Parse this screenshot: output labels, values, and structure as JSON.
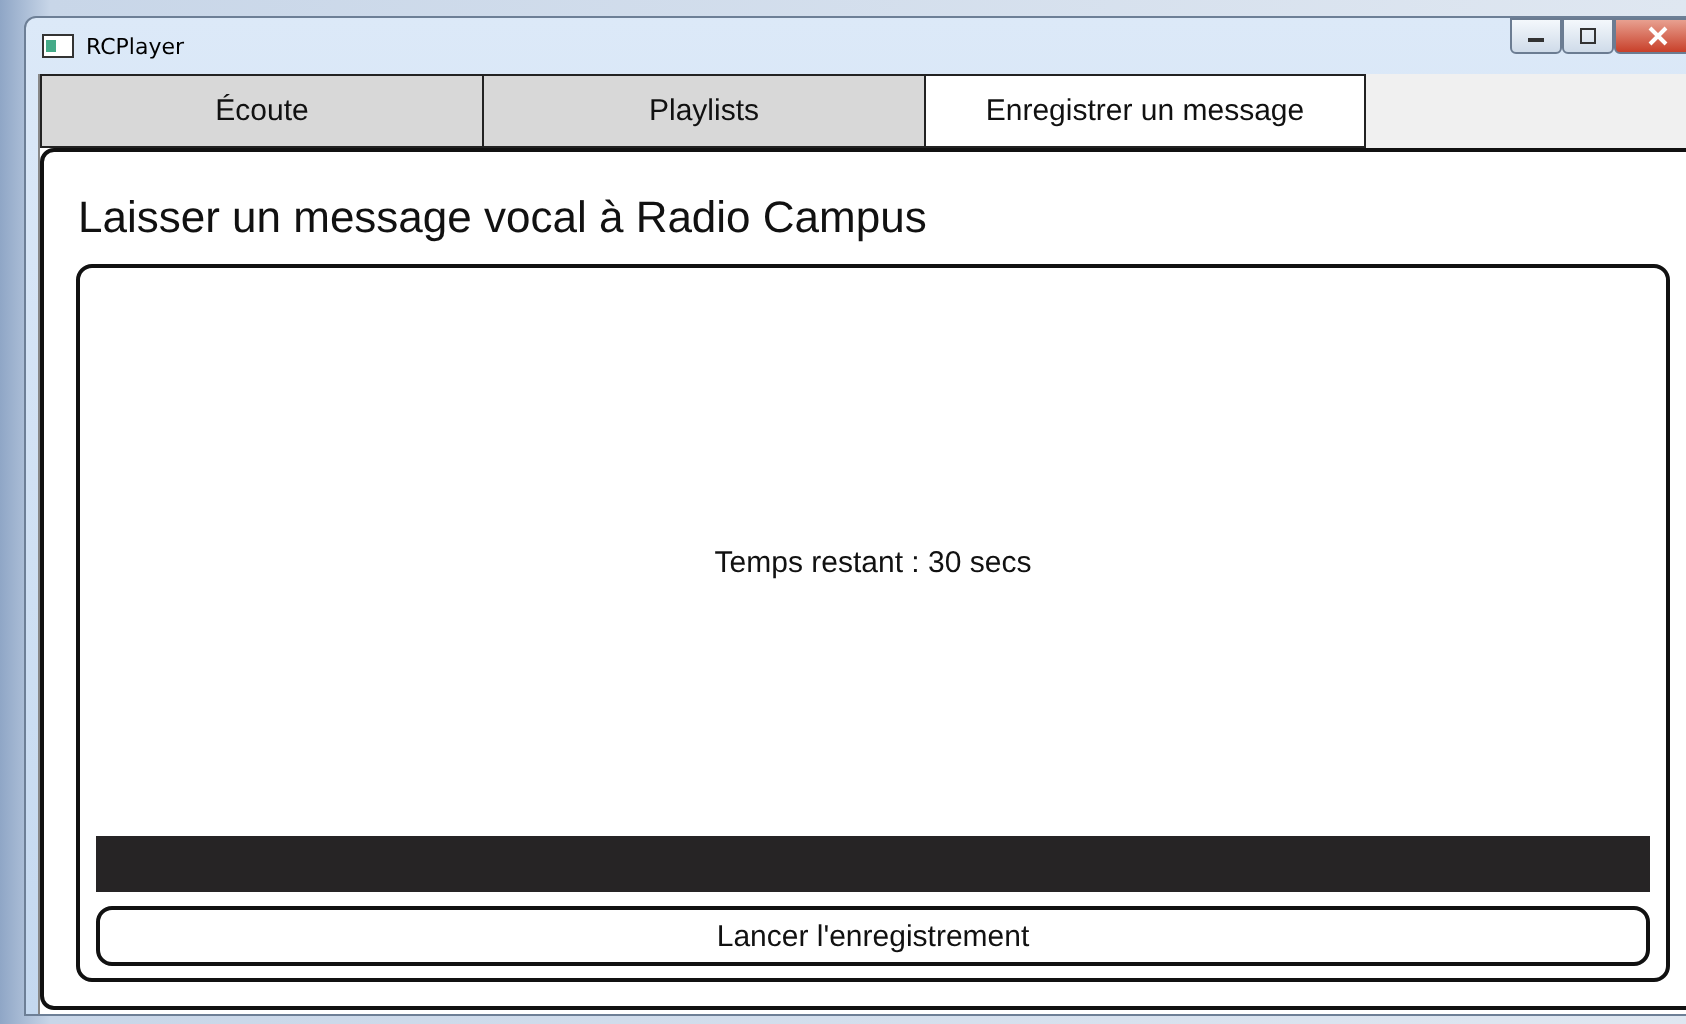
{
  "window": {
    "title": "RCPlayer"
  },
  "tabs": [
    {
      "label": "Écoute",
      "selected": false
    },
    {
      "label": "Playlists",
      "selected": false
    },
    {
      "label": "Enregistrer un message",
      "selected": true
    }
  ],
  "heading": "Laisser un message vocal à Radio Campus",
  "timer": "Temps restant : 30 secs",
  "progress": {
    "level": 1
  },
  "record_button": "Lancer l'enregistrement"
}
